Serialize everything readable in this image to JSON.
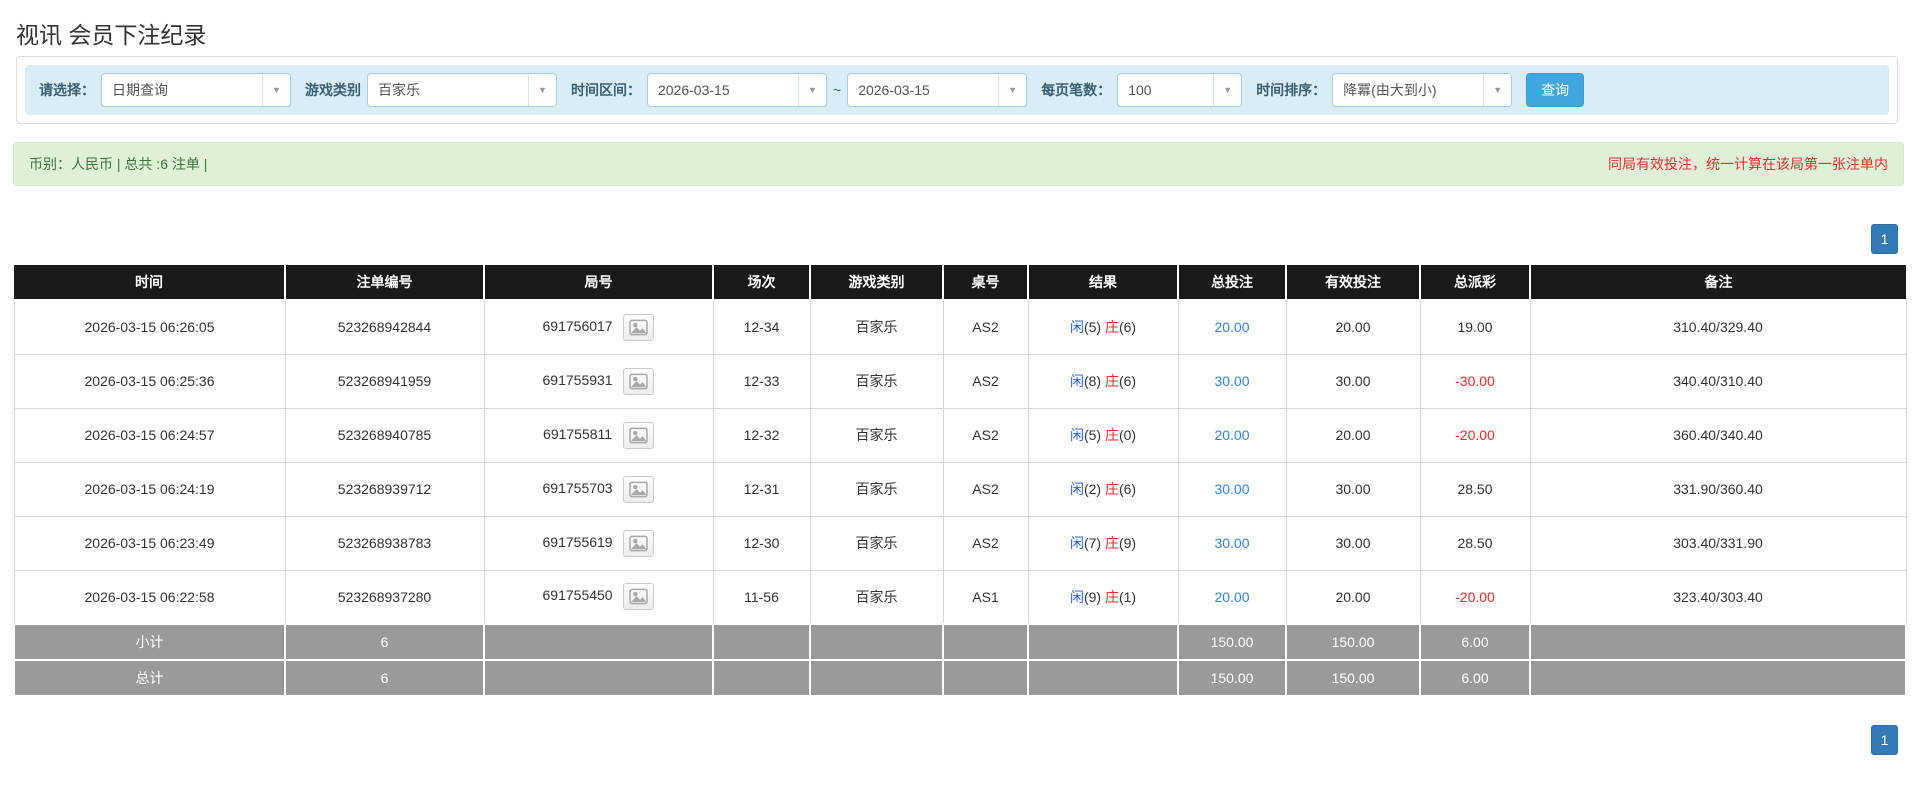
{
  "page_title": "视讯 会员下注纪录",
  "filters": {
    "select_label": "请选择：",
    "select_value": "日期查询",
    "game_type_label": "游戏类别",
    "game_type_value": "百家乐",
    "time_range_label": "时间区间：",
    "date_from": "2026-03-15",
    "tilde": "~",
    "date_to": "2026-03-15",
    "page_size_label": "每页笔数：",
    "page_size_value": "100",
    "sort_label": "时间排序：",
    "sort_value": "降冪(由大到小)",
    "search_button": "查询"
  },
  "summary": {
    "left_text": "币别：人民币 | 总共 :6 注单 |",
    "right_note": "同局有效投注，统一计算在该局第一张注单内"
  },
  "pagination": {
    "page": "1"
  },
  "colors": {
    "filter_bg": "#d9edf7",
    "accent_blue": "#3fa7db",
    "pagination_blue": "#337ab7",
    "success_bg": "#dff0d8",
    "success_text": "#3c763d",
    "warning_red": "#e03131",
    "header_bg": "#1a1a1a",
    "subtotal_bg": "#9a9a9a",
    "link_blue": "#3583db",
    "player_blue": "#2d64d8",
    "banker_red": "#ee2c2c",
    "negative_red": "#ee2c2c"
  },
  "table": {
    "headers": [
      "时间",
      "注单编号",
      "局号",
      "场次",
      "游戏类别",
      "桌号",
      "结果",
      "总投注",
      "有效投注",
      "总派彩",
      "备注"
    ],
    "rows": [
      {
        "time": "2026-03-15 06:26:05",
        "bet_id": "523268942844",
        "round_id": "691756017",
        "session": "12-34",
        "game": "百家乐",
        "table_no": "AS2",
        "result": {
          "player_label": "闲",
          "player_value": "(5)",
          "banker_label": "庄",
          "banker_value": "(6)"
        },
        "total_bet": "20.00",
        "valid_bet": "20.00",
        "payout": "19.00",
        "remark": "310.40/329.40"
      },
      {
        "time": "2026-03-15 06:25:36",
        "bet_id": "523268941959",
        "round_id": "691755931",
        "session": "12-33",
        "game": "百家乐",
        "table_no": "AS2",
        "result": {
          "player_label": "闲",
          "player_value": "(8)",
          "banker_label": "庄",
          "banker_value": "(6)"
        },
        "total_bet": "30.00",
        "valid_bet": "30.00",
        "payout": "-30.00",
        "remark": "340.40/310.40"
      },
      {
        "time": "2026-03-15 06:24:57",
        "bet_id": "523268940785",
        "round_id": "691755811",
        "session": "12-32",
        "game": "百家乐",
        "table_no": "AS2",
        "result": {
          "player_label": "闲",
          "player_value": "(5)",
          "banker_label": "庄",
          "banker_value": "(0)"
        },
        "total_bet": "20.00",
        "valid_bet": "20.00",
        "payout": "-20.00",
        "remark": "360.40/340.40"
      },
      {
        "time": "2026-03-15 06:24:19",
        "bet_id": "523268939712",
        "round_id": "691755703",
        "session": "12-31",
        "game": "百家乐",
        "table_no": "AS2",
        "result": {
          "player_label": "闲",
          "player_value": "(2)",
          "banker_label": "庄",
          "banker_value": "(6)"
        },
        "total_bet": "30.00",
        "valid_bet": "30.00",
        "payout": "28.50",
        "remark": "331.90/360.40"
      },
      {
        "time": "2026-03-15 06:23:49",
        "bet_id": "523268938783",
        "round_id": "691755619",
        "session": "12-30",
        "game": "百家乐",
        "table_no": "AS2",
        "result": {
          "player_label": "闲",
          "player_value": "(7)",
          "banker_label": "庄",
          "banker_value": "(9)"
        },
        "total_bet": "30.00",
        "valid_bet": "30.00",
        "payout": "28.50",
        "remark": "303.40/331.90"
      },
      {
        "time": "2026-03-15 06:22:58",
        "bet_id": "523268937280",
        "round_id": "691755450",
        "session": "11-56",
        "game": "百家乐",
        "table_no": "AS1",
        "result": {
          "player_label": "闲",
          "player_value": "(9)",
          "banker_label": "庄",
          "banker_value": "(1)"
        },
        "total_bet": "20.00",
        "valid_bet": "20.00",
        "payout": "-20.00",
        "remark": "323.40/303.40"
      }
    ],
    "subtotal": {
      "label": "小计",
      "count": "6",
      "total_bet": "150.00",
      "valid_bet": "150.00",
      "payout": "6.00"
    },
    "total": {
      "label": "总计",
      "count": "6",
      "total_bet": "150.00",
      "valid_bet": "150.00",
      "payout": "6.00"
    }
  }
}
